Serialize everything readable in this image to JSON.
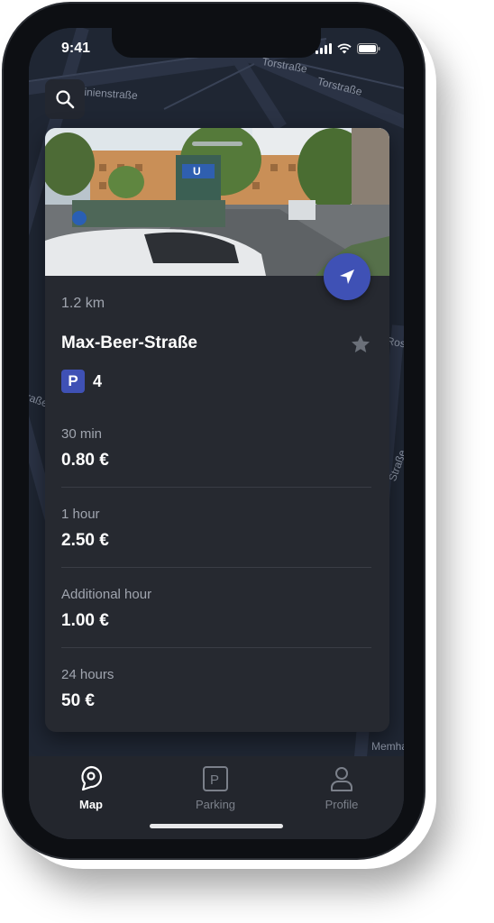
{
  "status_bar": {
    "time": "9:41"
  },
  "map": {
    "street_labels": [
      "inienstraße",
      "Torstraße",
      "Torstraße",
      "Ros",
      "raße",
      "Straße",
      "Memha"
    ]
  },
  "search": {
    "icon": "search-icon"
  },
  "card": {
    "distance": "1.2 km",
    "street_name": "Max-Beer-Straße",
    "parking_badge": "P",
    "spots": "4",
    "prices": [
      {
        "label": "30 min",
        "value": "0.80 €"
      },
      {
        "label": "1 hour",
        "value": "2.50 €"
      },
      {
        "label": "Additional hour",
        "value": "1.00 €"
      },
      {
        "label": "24 hours",
        "value": "50 €"
      }
    ]
  },
  "tabbar": {
    "tabs": [
      {
        "label": "Map",
        "icon": "map-pin-icon",
        "active": true
      },
      {
        "label": "Parking",
        "icon": "parking-icon",
        "active": false
      },
      {
        "label": "Profile",
        "icon": "profile-icon",
        "active": false
      }
    ]
  },
  "colors": {
    "accent": "#3f51b5",
    "card_bg": "#262930",
    "map_bg": "#1f2633",
    "tab_active": "#ffffff",
    "tab_inactive": "#7b808a"
  }
}
